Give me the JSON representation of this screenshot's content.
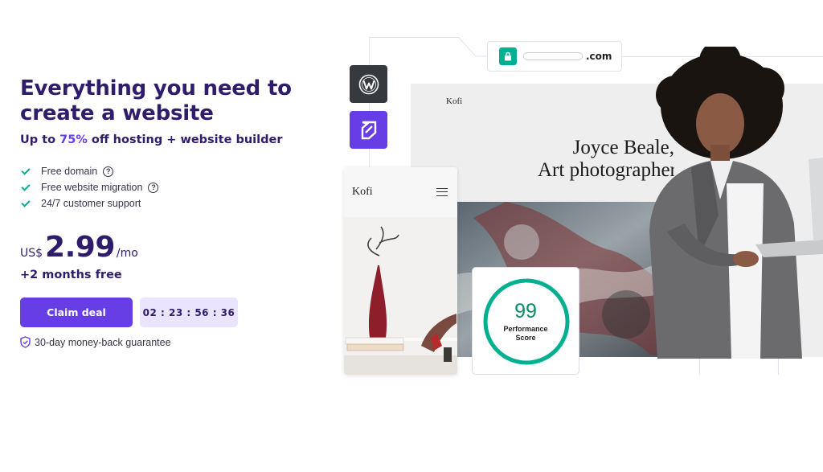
{
  "hero": {
    "headline_line1": "Everything you need to",
    "headline_line2": "create a website",
    "subline_prefix": "Up to ",
    "subline_discount": "75%",
    "subline_suffix": " off hosting + website builder",
    "features": [
      {
        "label": "Free domain",
        "has_help": true
      },
      {
        "label": "Free website migration",
        "has_help": true
      },
      {
        "label": "24/7 customer support",
        "has_help": false
      }
    ],
    "help_icon_glyph": "?",
    "currency": "US$",
    "price": "2.99",
    "period": "/mo",
    "bonus": "+2 months free",
    "cta_label": "Claim deal",
    "countdown": "02 : 23 : 56 : 36",
    "guarantee": "30-day money-back guarantee"
  },
  "illustration": {
    "domain_ext": ".com",
    "site_logo": "Kofi",
    "site_heading_line1": "Joyce Beale,",
    "site_heading_line2": "Art photographer",
    "mobile_logo": "Kofi",
    "score_value": "99",
    "score_label_line1": "Performance",
    "score_label_line2": "Score",
    "score_fraction": 0.99,
    "icons": [
      "lock-icon",
      "wordpress-icon",
      "website-builder-icon",
      "menu-icon",
      "check-icon",
      "help-icon",
      "shield-icon"
    ]
  },
  "colors": {
    "brand_primary": "#673de6",
    "heading": "#2f1c6a",
    "accent_green": "#00b090",
    "countdown_bg": "#ebe4ff",
    "wordpress_tile": "#36393d"
  }
}
